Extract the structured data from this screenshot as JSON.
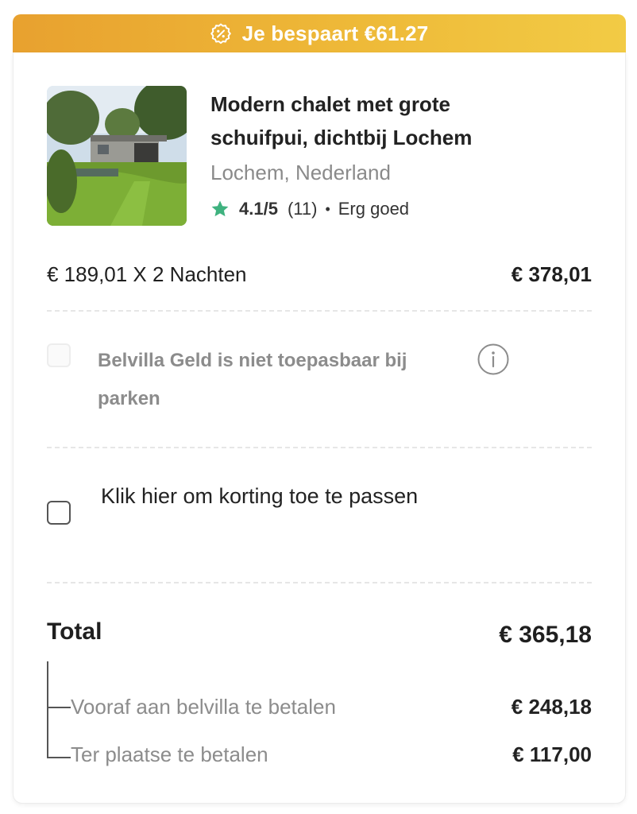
{
  "banner": {
    "text": "Je bespaart €61.27",
    "icon": "discount-badge-icon",
    "gradient_start": "#e8a12f",
    "gradient_end": "#f2cb45"
  },
  "property": {
    "title": "Modern chalet met grote schuifpui, dichtbij Lochem",
    "location": "Lochem, Nederland",
    "rating": {
      "score": "4.1/5",
      "count": "(11)",
      "separator": "•",
      "label": "Erg goed",
      "star_color": "#3fb27f"
    }
  },
  "pricing": {
    "nights_label": "€ 189,01 X 2 Nachten",
    "nights_amount": "€ 378,01"
  },
  "belvilla_money": {
    "checked": false,
    "disabled": true,
    "text": "Belvilla Geld is niet toepasbaar bij parken",
    "icon": "info-icon"
  },
  "discount": {
    "checked": false,
    "text": "Klik hier om korting toe te passen"
  },
  "total": {
    "label": "Total",
    "amount": "€ 365,18",
    "breakdown": [
      {
        "label": "Vooraf aan belvilla te betalen",
        "amount": "€ 248,18"
      },
      {
        "label": "Ter plaatse te betalen",
        "amount": "€ 117,00"
      }
    ]
  }
}
